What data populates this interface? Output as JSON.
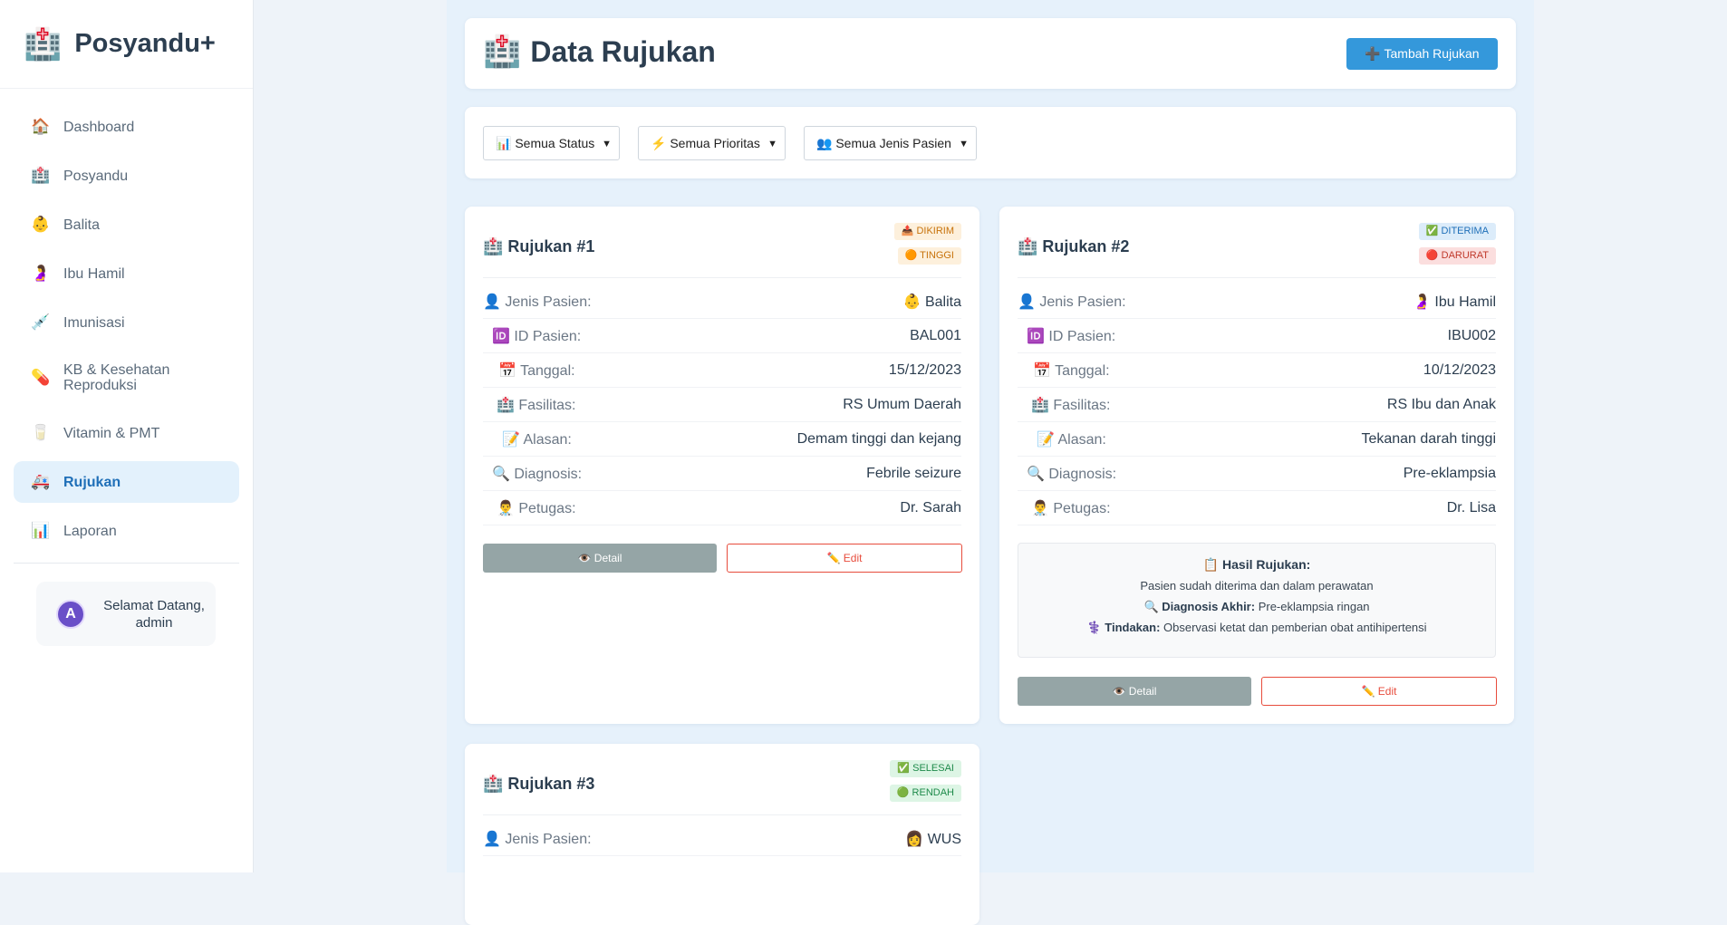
{
  "app": {
    "brand_icon": "🏥",
    "brand_name": "Posyandu+"
  },
  "sidebar": {
    "items": [
      {
        "icon": "🏠",
        "label": "Dashboard"
      },
      {
        "icon": "🏥",
        "label": "Posyandu"
      },
      {
        "icon": "👶",
        "label": "Balita"
      },
      {
        "icon": "🤰",
        "label": "Ibu Hamil"
      },
      {
        "icon": "💉",
        "label": "Imunisasi"
      },
      {
        "icon": "💊",
        "label": "KB & Kesehatan Reproduksi"
      },
      {
        "icon": "🥛",
        "label": "Vitamin & PMT"
      },
      {
        "icon": "🚑",
        "label": "Rujukan"
      },
      {
        "icon": "📊",
        "label": "Laporan"
      }
    ],
    "active_index": 7,
    "user": {
      "avatar_letter": "A",
      "welcome": "Selamat Datang, admin"
    }
  },
  "header": {
    "title_icon": "🏥",
    "title": "Data Rujukan",
    "add_button": "➕ Tambah Rujukan"
  },
  "filters": {
    "status": "📊 Semua Status",
    "priority": "⚡ Semua Prioritas",
    "patient_type": "👥 Semua Jenis Pasien"
  },
  "labels": {
    "jenis": "👤 Jenis Pasien:",
    "id": "🆔 ID Pasien:",
    "tanggal": "📅 Tanggal:",
    "fasilitas": "🏥 Fasilitas:",
    "alasan": "📝 Alasan:",
    "diagnosis": "🔍 Diagnosis:",
    "petugas": "👨‍⚕️ Petugas:",
    "detail_button": "👁️ Detail",
    "edit_button": "✏️ Edit"
  },
  "referrals": [
    {
      "title": "🏥 Rujukan #1",
      "status": "📤 DIKIRIM",
      "priority": "🟠 TINGGI",
      "jenis": "👶 Balita",
      "id": "BAL001",
      "tanggal": "15/12/2023",
      "fasilitas": "RS Umum Daerah",
      "alasan": "Demam tinggi dan kejang",
      "diagnosis": "Febrile seizure",
      "petugas": "Dr. Sarah"
    },
    {
      "title": "🏥 Rujukan #2",
      "status": "✅ DITERIMA",
      "priority": "🔴 DARURAT",
      "jenis": "🤰 Ibu Hamil",
      "id": "IBU002",
      "tanggal": "10/12/2023",
      "fasilitas": "RS Ibu dan Anak",
      "alasan": "Tekanan darah tinggi",
      "diagnosis": "Pre-eklampsia",
      "petugas": "Dr. Lisa",
      "hasil": {
        "title": "📋 Hasil Rujukan:",
        "text": "Pasien sudah diterima dan dalam perawatan",
        "diag_label": "🔍 Diagnosis Akhir:",
        "diag_value": " Pre-eklampsia ringan",
        "tindakan_label": "⚕️ Tindakan:",
        "tindakan_value": " Observasi ketat dan pemberian obat antihipertensi"
      }
    },
    {
      "title": "🏥 Rujukan #3",
      "status": "✅ SELESAI",
      "priority": "🟢 RENDAH",
      "jenis": "👩 WUS"
    }
  ],
  "colors": {
    "accent": "#3498db",
    "active_nav_bg": "#e3f1fc",
    "edit_red": "#e74c3c",
    "detail_gray": "#95a5a6"
  }
}
